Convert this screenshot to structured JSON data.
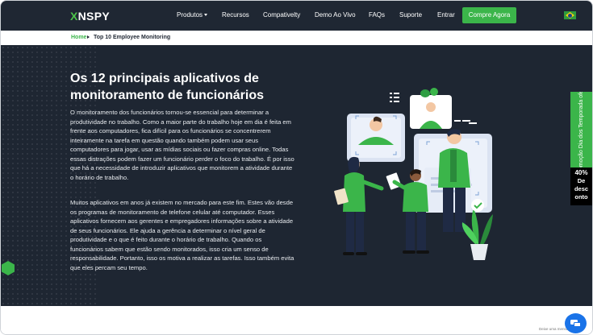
{
  "header": {
    "logo_a": "X",
    "logo_b": "NSPY",
    "nav": [
      "Produtos",
      "Recursos",
      "Compativelty",
      "Demo Ao Vivo",
      "FAQs",
      "Suporte",
      "Entrar"
    ],
    "cta": "Compre Agora",
    "flag_icon": "brazil-flag-icon"
  },
  "breadcrumb": {
    "home": "Home",
    "current": "Top 10 Employee Monitoring"
  },
  "hero": {
    "title": "Os 12 principais aplicativos de monitoramento de funcionários",
    "paragraph1": "O monitoramento dos funcionários tornou-se essencial para determinar a produtividade no trabalho. Como a maior parte do trabalho hoje em dia é feita em frente aos computadores, fica difícil para os funcionários se concentrerem inteiramente na tarefa em questão quando também podem usar seus computadores para jogar, usar as mídias sociais ou fazer compras online. Todas essas distrações podem fazer um funcionário perder o foco do trabalho. É por isso que há a necessidade de introduzir aplicativos que monitorem a atividade durante o horário de trabalho.",
    "paragraph2": "Muitos aplicativos em anos já existem no mercado para este fim. Estes vão desde os programas de monitoramento de telefone celular até computador. Esses aplicativos fornecem aos gerentes e empregadores informações sobre a atividade de seus funcionários. Ele ajuda a gerência a determinar o nível geral de produtividade e o que é feito durante o horário de trabalho. Quando os funcionários sabem que estão sendo monitorados, isso cria um senso de responsabilidade. Portanto, isso os motiva a realizar as tarefas. Isso também evita que eles percam seu tempo."
  },
  "promo": {
    "tab_text": "Promoção Dia dos Temporada oferta",
    "discount_value": "40%",
    "discount_label1": "De",
    "discount_label2": "desc",
    "discount_label3": "onto"
  },
  "chat": {
    "label": "Deixe uma mensagem"
  },
  "colors": {
    "nav_bg": "#1f2733",
    "hero_bg": "#1e2632",
    "accent": "#3bb54a",
    "chat": "#1a73e8"
  }
}
